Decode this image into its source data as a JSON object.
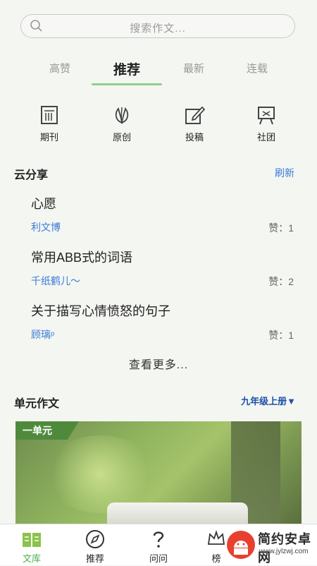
{
  "search": {
    "placeholder": "搜索作文..."
  },
  "tabs": [
    {
      "label": "高赞",
      "active": false
    },
    {
      "label": "推荐",
      "active": true
    },
    {
      "label": "最新",
      "active": false
    },
    {
      "label": "连载",
      "active": false
    }
  ],
  "categories": [
    {
      "label": "期刊",
      "icon": "magazine-icon"
    },
    {
      "label": "原创",
      "icon": "leaf-icon"
    },
    {
      "label": "投稿",
      "icon": "edit-icon"
    },
    {
      "label": "社团",
      "icon": "club-icon"
    }
  ],
  "cloud_share": {
    "title": "云分享",
    "refresh_label": "刷新",
    "posts": [
      {
        "title": "心愿",
        "author": "利文博",
        "likes": "赞：1"
      },
      {
        "title": "常用ABB式的词语",
        "author": "千纸鹤儿～",
        "likes": "赞：2"
      },
      {
        "title": "关于描写心情愤怒的句子",
        "author": "顾璃ᵖ",
        "likes": "赞：1"
      }
    ],
    "more_label": "查看更多..."
  },
  "unit_essay": {
    "title": "单元作文",
    "grade_label": "九年级上册▼",
    "banner_badge": "一单元"
  },
  "bottom_nav": [
    {
      "label": "文库",
      "icon": "book-icon",
      "active": true
    },
    {
      "label": "推荐",
      "icon": "compass-icon",
      "active": false
    },
    {
      "label": "问问",
      "icon": "question-icon",
      "active": false
    },
    {
      "label": "榜",
      "icon": "crown-icon",
      "active": false
    }
  ],
  "watermark": {
    "title": "简约安卓网",
    "url": "www.jylzwj.com"
  },
  "colors": {
    "accent_green": "#8fcf8f",
    "link_blue": "#3a7bd5",
    "grade_blue": "#1f4fa8",
    "active_nav": "#4caf50"
  }
}
